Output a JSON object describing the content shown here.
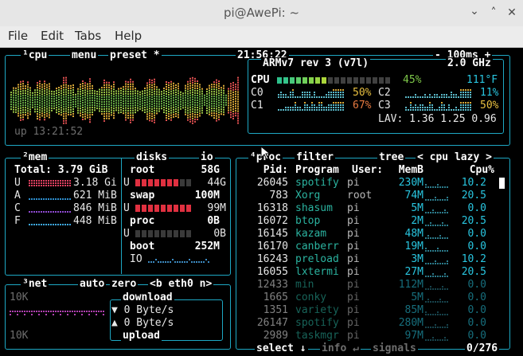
{
  "window": {
    "title": "pi@AwePi: ~",
    "min_icon": "minimize-icon",
    "max_icon": "maximize-icon",
    "close_icon": "close-icon"
  },
  "menu": [
    "File",
    "Edit",
    "Tabs",
    "Help"
  ],
  "cpu_box": {
    "tabs": [
      "¹cpu",
      "menu",
      "preset *"
    ],
    "clock": "21:56:22",
    "update": "- 100ms +",
    "uptime": "up 13:21:52",
    "model": "ARMv7 rev 3 (v7l)",
    "freq": "2.0 GHz",
    "total": {
      "label": "CPU",
      "pct": "45%",
      "pct_value": 0.45,
      "temp": "111°F"
    },
    "cores": [
      {
        "label": "C0",
        "pct": "50%"
      },
      {
        "label": "C2",
        "pct": "11%"
      },
      {
        "label": "C1",
        "pct": "67%"
      },
      {
        "label": "C3",
        "pct": "50%"
      }
    ],
    "lav": "LAV: 1.36 1.25 0.96"
  },
  "mem_box": {
    "title": "²mem",
    "total": "Total: 3.79 GiB",
    "rows": [
      {
        "label": "U",
        "value": "3.18 Gi"
      },
      {
        "label": "A",
        "value": "621 MiB"
      },
      {
        "label": "C",
        "value": "846 MiB"
      },
      {
        "label": "F",
        "value": "448 MiB"
      }
    ]
  },
  "disks_box": {
    "title": "disks",
    "io": "io",
    "disks": [
      {
        "name": "root",
        "size": "58G",
        "used_label": "U",
        "used": "44G",
        "used_frac": 0.76
      },
      {
        "name": "swap",
        "size": "100M",
        "used_label": "U",
        "used": "99M",
        "used_frac": 0.99
      },
      {
        "name": "proc",
        "size": "0B",
        "used_label": "U",
        "used": "0B",
        "used_frac": 0.0
      },
      {
        "name": "boot",
        "size": "252M",
        "io_label": "IO"
      }
    ]
  },
  "net_box": {
    "title": "³net",
    "auto": "auto",
    "zero": "zero",
    "iface": "<b eth0 n>",
    "scale_top": "10K",
    "scale_bottom": "10K",
    "download_label": "download",
    "download": "▼ 0 Byte/s",
    "upload": "▲ 0 Byte/s",
    "upload_label": "upload"
  },
  "proc_box": {
    "title": "⁴proc",
    "filter": "filter",
    "tree": "tree",
    "sort": "< cpu lazy >",
    "headers": [
      "Pid:",
      "Program",
      "User:",
      "MemB",
      "Cpu%"
    ],
    "rows": [
      {
        "pid": "26045",
        "prog": "spotify",
        "user": "pi",
        "mem": "230M",
        "cpu": "10.2"
      },
      {
        "pid": "783",
        "prog": "Xorg",
        "user": "root",
        "mem": "74M",
        "cpu": "20.5"
      },
      {
        "pid": "16318",
        "prog": "shasum",
        "user": "pi",
        "mem": "5M",
        "cpu": "0.0"
      },
      {
        "pid": "16072",
        "prog": "btop",
        "user": "pi",
        "mem": "2M",
        "cpu": "20.5"
      },
      {
        "pid": "16145",
        "prog": "kazam",
        "user": "pi",
        "mem": "48M",
        "cpu": "0.0"
      },
      {
        "pid": "16170",
        "prog": "canberr",
        "user": "pi",
        "mem": "19M",
        "cpu": "0.0"
      },
      {
        "pid": "16243",
        "prog": "preload",
        "user": "pi",
        "mem": "3M",
        "cpu": "10.2"
      },
      {
        "pid": "16055",
        "prog": "lxtermi",
        "user": "pi",
        "mem": "27M",
        "cpu": "20.5"
      },
      {
        "pid": "12433",
        "prog": "min",
        "user": "pi",
        "mem": "112M",
        "cpu": "0.0"
      },
      {
        "pid": "1665",
        "prog": "conky",
        "user": "pi",
        "mem": "5M",
        "cpu": "0.0"
      },
      {
        "pid": "1351",
        "prog": "variety",
        "user": "pi",
        "mem": "85M",
        "cpu": "0.0"
      },
      {
        "pid": "26147",
        "prog": "spotify",
        "user": "pi",
        "mem": "280M",
        "cpu": "0.0"
      },
      {
        "pid": "2989",
        "prog": "taskmgr",
        "user": "pi",
        "mem": "97M",
        "cpu": "0.0"
      }
    ],
    "footer_select": "select ↓",
    "footer_info": "info ↵",
    "footer_signals": "signals",
    "count": "0/276"
  },
  "colors": {
    "border": "#1ea8c4",
    "accent_green": "#7ec84a",
    "accent_cyan": "#29c6e0",
    "mem_red": "#e04060"
  }
}
